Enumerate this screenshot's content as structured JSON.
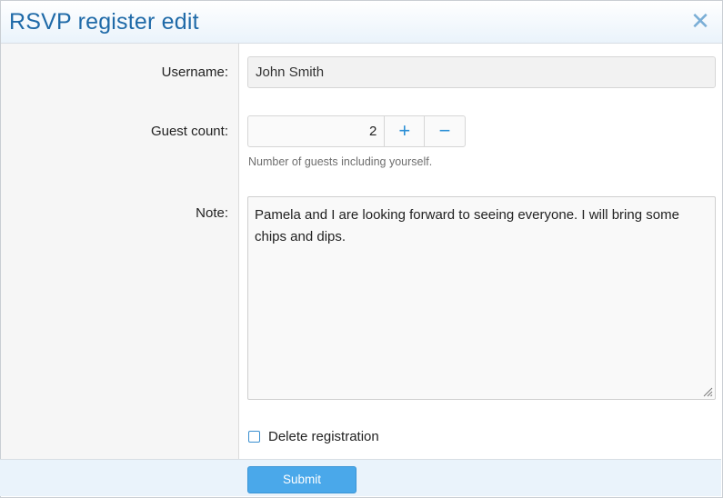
{
  "dialog": {
    "title": "RSVP register edit",
    "close_glyph": "✕",
    "close_icon": "close-icon"
  },
  "form": {
    "username": {
      "label": "Username:",
      "value": "John Smith"
    },
    "guest_count": {
      "label": "Guest count:",
      "value": "2",
      "plus_glyph": "+",
      "minus_glyph": "−",
      "hint": "Number of guests including yourself."
    },
    "note": {
      "label": "Note:",
      "value": "Pamela and I are looking forward to seeing everyone. I will bring some chips and dips."
    },
    "delete_registration": {
      "label": "Delete registration",
      "checked": false
    }
  },
  "footer": {
    "submit_label": "Submit"
  },
  "colors": {
    "accent": "#1f6aa8",
    "button": "#4aa8ea",
    "header_bg": "#eaf3fb"
  }
}
